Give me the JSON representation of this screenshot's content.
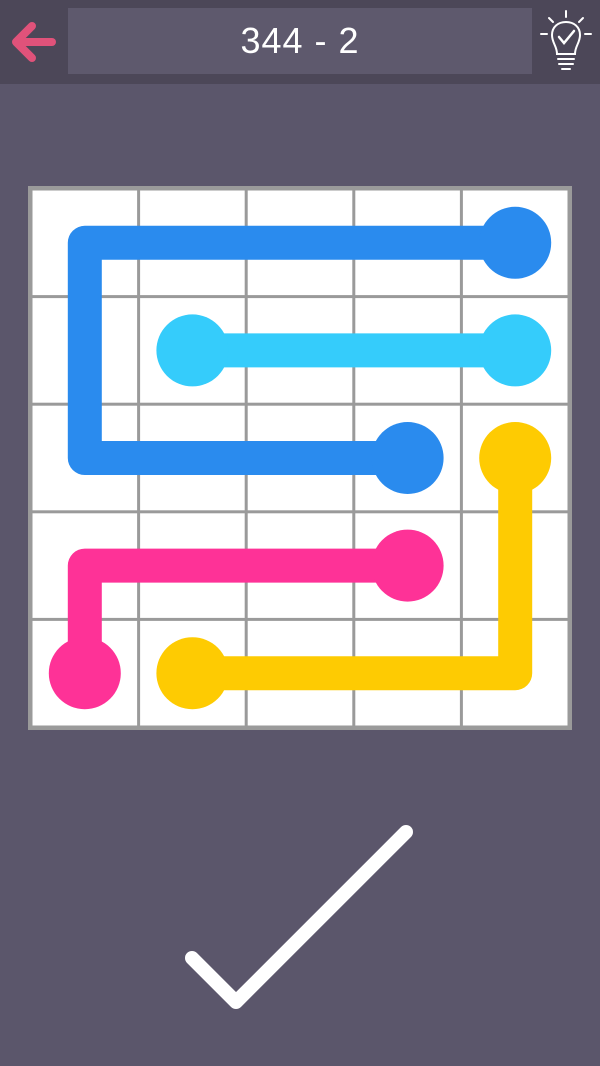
{
  "header": {
    "level_label": "344 - 2",
    "back_icon": "back-arrow-icon",
    "hint_icon": "lightbulb-hint-icon"
  },
  "colors": {
    "background": "#5b566b",
    "topbar": "#4c4758",
    "back_arrow": "#e0527a",
    "blue": "#2a8bee",
    "cyan": "#35ccfb",
    "pink": "#fe3297",
    "yellow": "#fecb02",
    "grid_line": "#9a9a9a",
    "cell": "#ffffff"
  },
  "board": {
    "rows": 5,
    "cols": 5,
    "paths": [
      {
        "color": "blue",
        "cells": [
          [
            0,
            4
          ],
          [
            0,
            3
          ],
          [
            0,
            2
          ],
          [
            0,
            1
          ],
          [
            0,
            0
          ],
          [
            1,
            0
          ],
          [
            2,
            0
          ],
          [
            2,
            1
          ],
          [
            2,
            2
          ],
          [
            2,
            3
          ]
        ]
      },
      {
        "color": "cyan",
        "cells": [
          [
            1,
            1
          ],
          [
            1,
            2
          ],
          [
            1,
            3
          ],
          [
            1,
            4
          ]
        ]
      },
      {
        "color": "yellow",
        "cells": [
          [
            2,
            4
          ],
          [
            3,
            4
          ],
          [
            4,
            4
          ],
          [
            4,
            3
          ],
          [
            4,
            2
          ],
          [
            4,
            1
          ]
        ]
      },
      {
        "color": "pink",
        "cells": [
          [
            3,
            3
          ],
          [
            3,
            2
          ],
          [
            3,
            1
          ],
          [
            3,
            0
          ],
          [
            4,
            0
          ]
        ]
      }
    ]
  },
  "footer": {
    "status_icon": "checkmark-complete-icon"
  }
}
